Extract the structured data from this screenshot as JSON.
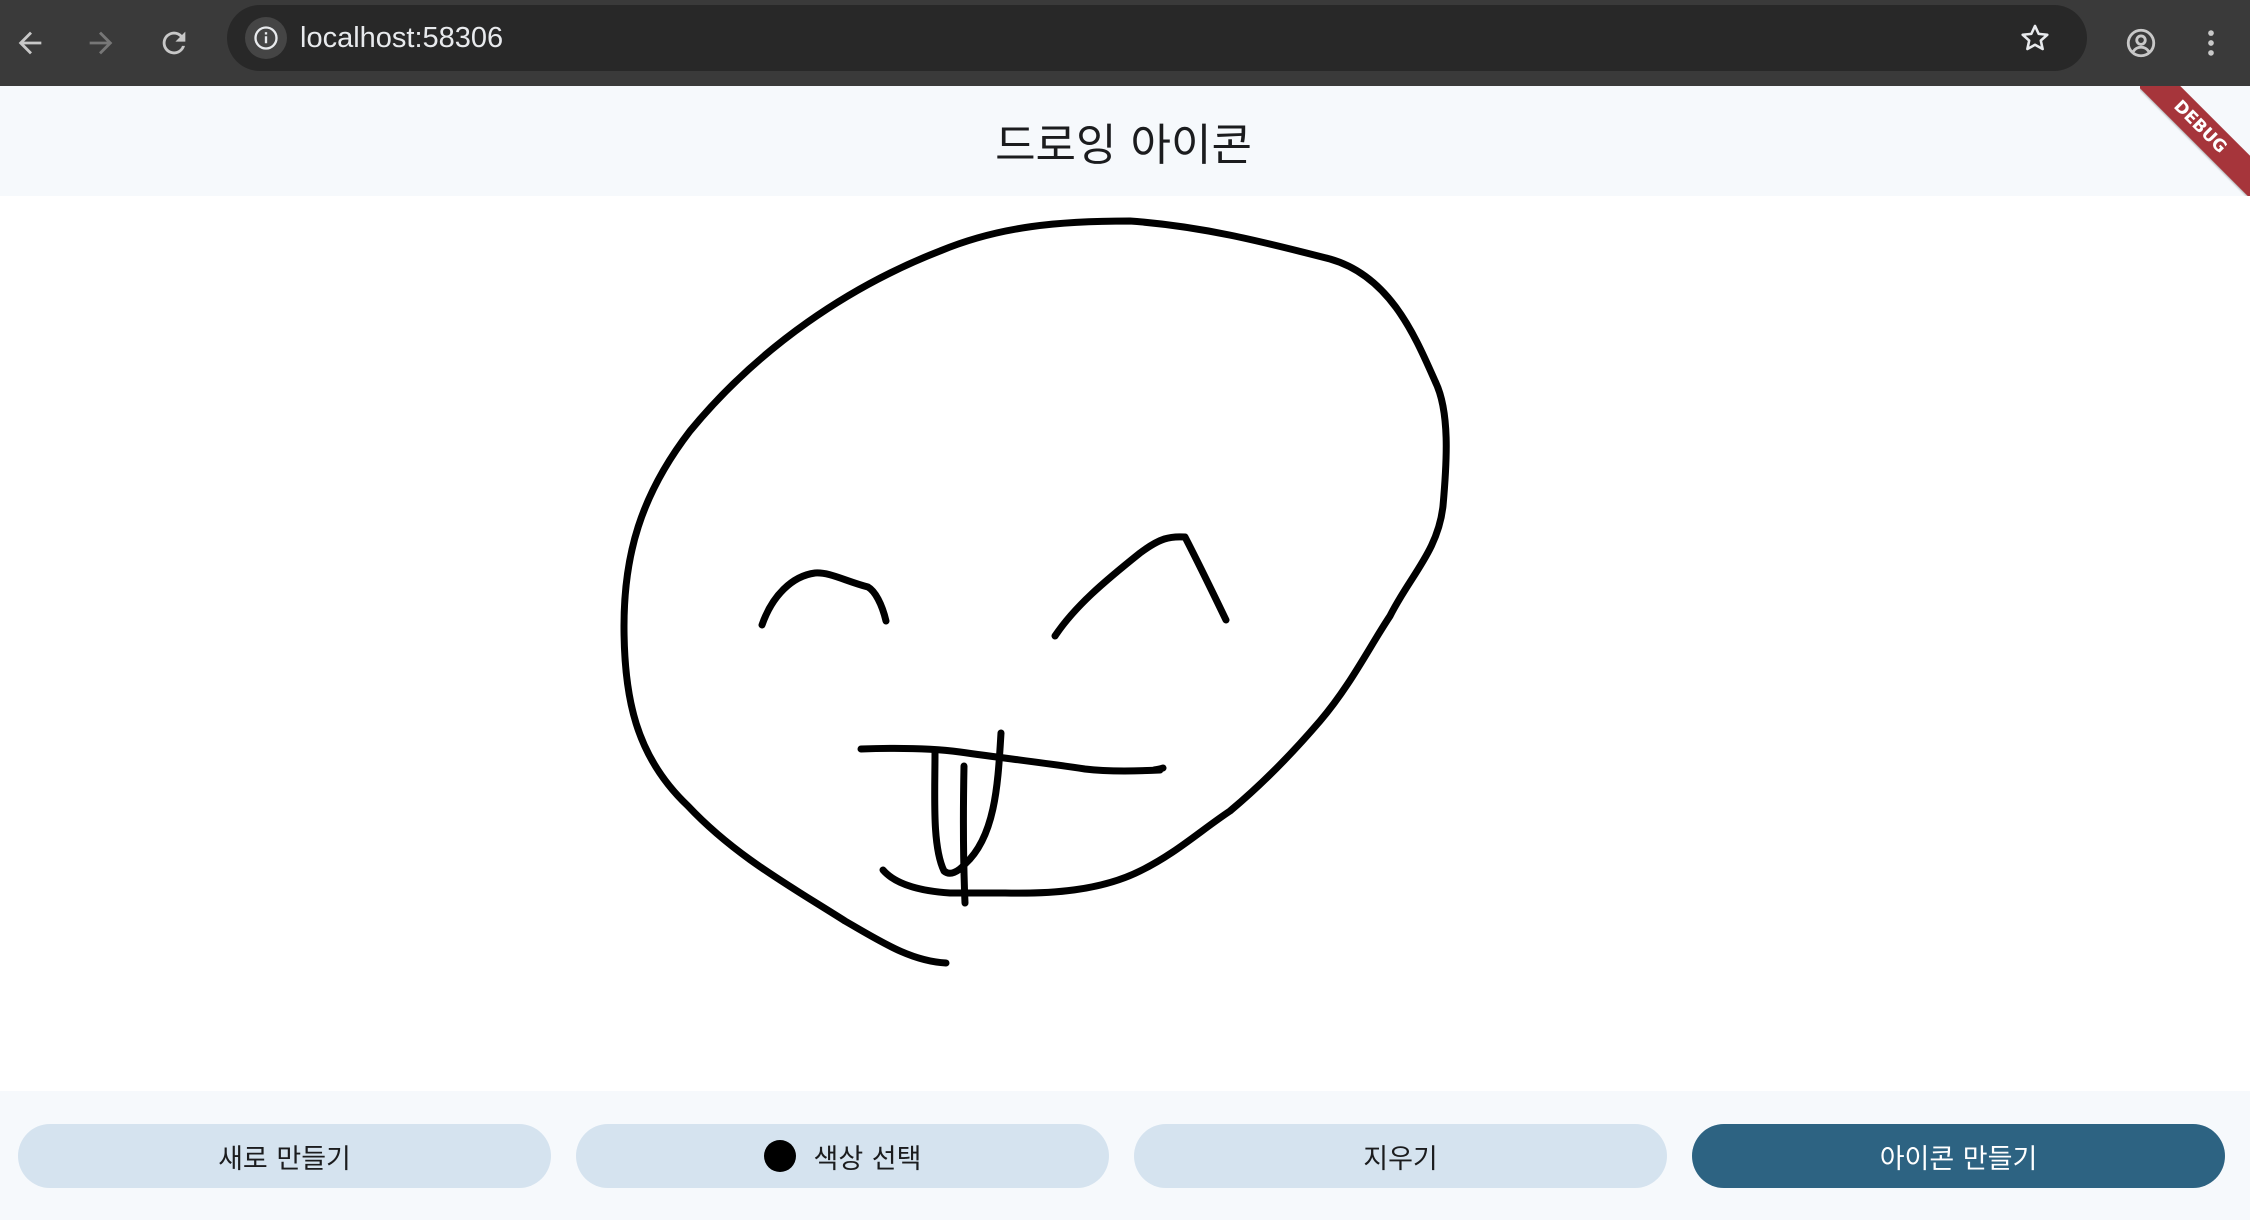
{
  "browser": {
    "url": "localhost:58306",
    "icons": {
      "back": "arrow-left-icon",
      "forward": "arrow-right-icon",
      "reload": "reload-icon",
      "site_info": "info-icon",
      "bookmark": "star-icon",
      "profile": "account-circle-icon",
      "menu": "more-vert-icon"
    }
  },
  "app": {
    "title": "드로잉 아이콘",
    "debug_banner": "DEBUG"
  },
  "canvas": {
    "stroke_color": "#000000"
  },
  "toolbar": {
    "new_label": "새로 만들기",
    "color_label": "색상 선택",
    "selected_color": "#000000",
    "erase_label": "지우기",
    "make_icon_label": "아이콘 만들기"
  },
  "colors": {
    "chrome_bg": "#3a3a3a",
    "header_bg": "#f6f9fc",
    "button_bg": "#d5e3ef",
    "primary_button_bg": "#2d6382",
    "debug_ribbon": "#a6353b"
  }
}
